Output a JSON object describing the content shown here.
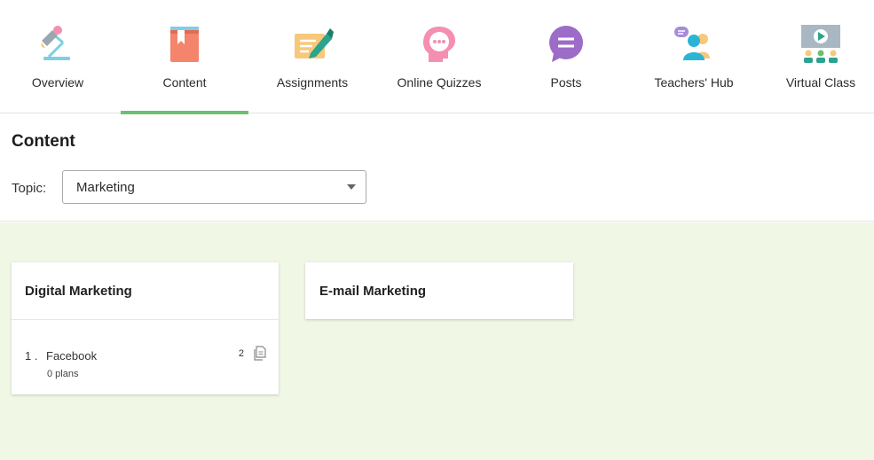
{
  "nav": {
    "items": [
      {
        "label": "Overview",
        "icon": "desk-lamp-icon"
      },
      {
        "label": "Content",
        "icon": "book-icon"
      },
      {
        "label": "Assignments",
        "icon": "pen-paper-icon"
      },
      {
        "label": "Online Quizzes",
        "icon": "head-thought-icon"
      },
      {
        "label": "Posts",
        "icon": "speech-bubble-icon"
      },
      {
        "label": "Teachers' Hub",
        "icon": "people-chat-icon"
      },
      {
        "label": "Virtual Class",
        "icon": "video-class-icon"
      }
    ],
    "active_index": 1,
    "active_color": "#6cc070"
  },
  "header": {
    "title": "Content",
    "topic_label": "Topic:",
    "topic_value": "Marketing"
  },
  "content": {
    "background": "#f0f7e5",
    "cards": [
      {
        "title": "Digital Marketing",
        "lessons": [
          {
            "number": "1 .",
            "name": "Facebook",
            "plans": "0 plans",
            "count": "2"
          }
        ]
      },
      {
        "title": "E-mail Marketing",
        "lessons": []
      }
    ]
  }
}
